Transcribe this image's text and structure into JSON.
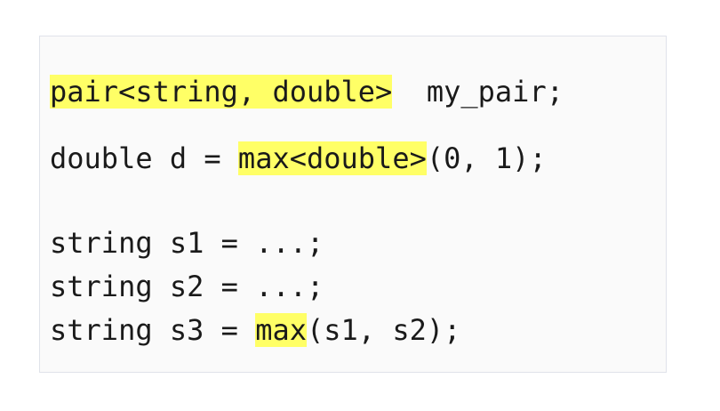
{
  "code": {
    "line1": {
      "highlight": "pair<string, double>",
      "rest": "  my_pair;"
    },
    "line2": {
      "before": "double d = ",
      "highlight": "max<double>",
      "after": "(0, 1);"
    },
    "line3": {
      "text": "string s1 = ...;"
    },
    "line4": {
      "text": "string s2 = ...;"
    },
    "line5": {
      "before": "string s3 = ",
      "highlight": "max",
      "after": "(s1, s2);"
    },
    "highlight_color": "#ffff66"
  }
}
